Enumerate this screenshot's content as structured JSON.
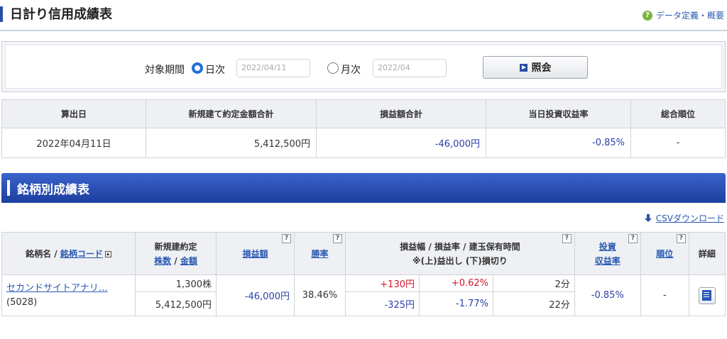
{
  "header": {
    "title": "日計り信用成績表",
    "help_link": "データ定義・概要"
  },
  "search": {
    "period_label": "対象期間",
    "daily_label": "日次",
    "daily_date": "2022/04/11",
    "monthly_label": "月次",
    "monthly_date": "2022/04",
    "submit_label": "照会",
    "selected": "daily"
  },
  "summary": {
    "headers": [
      "算出日",
      "新規建て約定金額合計",
      "損益額合計",
      "当日投資収益率",
      "総合順位"
    ],
    "row": {
      "date": "2022年04月11日",
      "contract_total": "5,412,500円",
      "pl_total": "-46,000円",
      "return_rate": "-0.85%",
      "rank": "-"
    }
  },
  "section": {
    "title": "銘柄別成績表",
    "csv_label": "CSVダウンロード"
  },
  "detail": {
    "headers": {
      "name": "銘柄名 /",
      "code": "銘柄コード",
      "contract_top": "新規建約定",
      "shares": "株数",
      "slash": "/",
      "amount": "金額",
      "pl": "損益額",
      "win_rate": "勝率",
      "range_top": "損益幅 / 損益率 / 建玉保有時間",
      "range_bottom": "※(上)益出し (下)損切り",
      "roi_top": "投資",
      "roi_bottom": "収益率",
      "rank": "順位",
      "details": "詳細"
    },
    "row": {
      "name": "セカンドサイトアナリ…",
      "code": "(5028)",
      "shares": "1,300株",
      "amount": "5,412,500円",
      "pl": "-46,000円",
      "win_rate": "38.46%",
      "gain_width": "+130円",
      "gain_rate": "+0.62%",
      "gain_time": "2分",
      "loss_width": "-325円",
      "loss_rate": "-1.77%",
      "loss_time": "22分",
      "roi": "-0.85%",
      "rank": "-"
    }
  },
  "colors": {
    "accent": "#1c3f9f",
    "positive": "#d2152a",
    "negative": "#2b3fa8",
    "link": "#2b5ab3"
  }
}
